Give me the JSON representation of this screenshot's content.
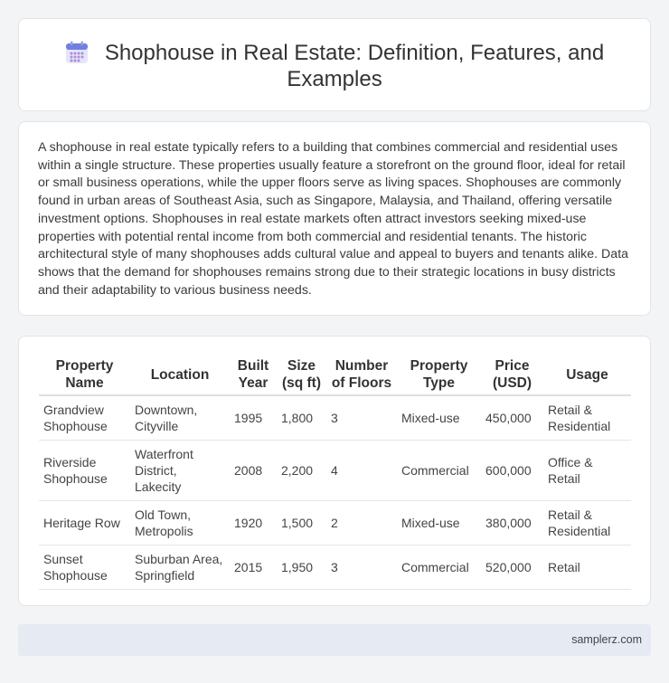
{
  "header": {
    "icon": "calendar-icon",
    "title": "Shophouse in Real Estate: Definition, Features, and Examples"
  },
  "intro": {
    "text": "A shophouse in real estate typically refers to a building that combines commercial and residential uses within a single structure. These properties usually feature a storefront on the ground floor, ideal for retail or small business operations, while the upper floors serve as living spaces. Shophouses are commonly found in urban areas of Southeast Asia, such as Singapore, Malaysia, and Thailand, offering versatile investment options. Shophouses in real estate markets often attract investors seeking mixed-use properties with potential rental income from both commercial and residential tenants. The historic architectural style of many shophouses adds cultural value and appeal to buyers and tenants alike. Data shows that the demand for shophouses remains strong due to their strategic locations in busy districts and their adaptability to various business needs."
  },
  "table": {
    "headers": [
      "Property Name",
      "Location",
      "Built Year",
      "Size (sq ft)",
      "Number of Floors",
      "Property Type",
      "Price (USD)",
      "Usage"
    ],
    "rows": [
      [
        "Grandview Shophouse",
        "Downtown, Cityville",
        "1995",
        "1,800",
        "3",
        "Mixed-use",
        "450,000",
        "Retail & Residential"
      ],
      [
        "Riverside Shophouse",
        "Waterfront District, Lakecity",
        "2008",
        "2,200",
        "4",
        "Commercial",
        "600,000",
        "Office & Retail"
      ],
      [
        "Heritage Row",
        "Old Town, Metropolis",
        "1920",
        "1,500",
        "2",
        "Mixed-use",
        "380,000",
        "Retail & Residential"
      ],
      [
        "Sunset Shophouse",
        "Suburban Area, Springfield",
        "2015",
        "1,950",
        "3",
        "Commercial",
        "520,000",
        "Retail"
      ]
    ]
  },
  "footer": {
    "site": "samplerz.com"
  },
  "colors": {
    "background": "#f3f4f6",
    "card": "#ffffff",
    "footer": "#e6eaf3",
    "icon_accent": "#6f6fd8"
  }
}
